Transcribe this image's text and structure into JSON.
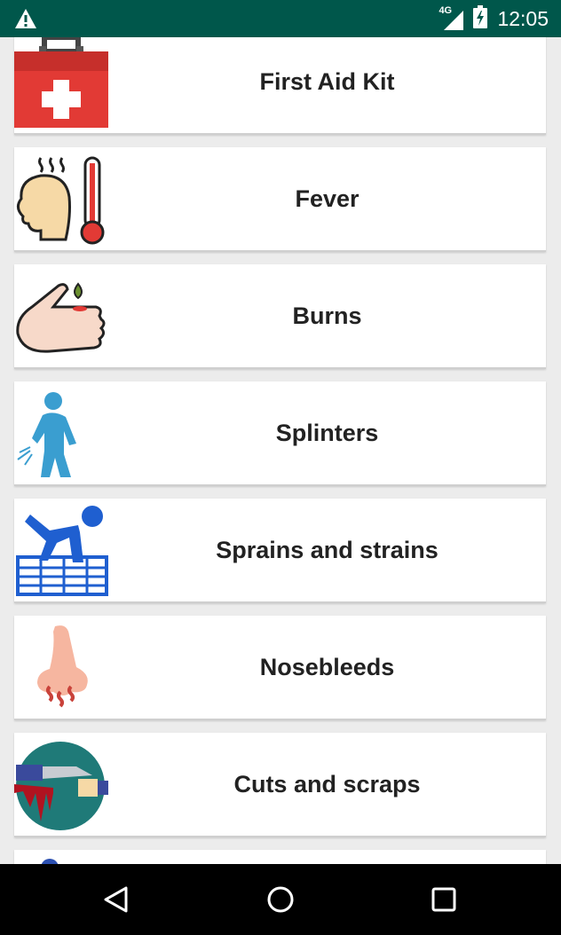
{
  "status_bar": {
    "warning_icon": "warning-triangle-icon",
    "network_label": "4G",
    "time": "12:05"
  },
  "items": [
    {
      "label": "First Aid Kit",
      "icon": "first-aid-kit-icon"
    },
    {
      "label": "Fever",
      "icon": "fever-thermometer-icon"
    },
    {
      "label": "Burns",
      "icon": "burned-hand-icon"
    },
    {
      "label": "Splinters",
      "icon": "person-splinter-icon"
    },
    {
      "label": "Sprains and strains",
      "icon": "slipping-person-icon"
    },
    {
      "label": "Nosebleeds",
      "icon": "nose-icon"
    },
    {
      "label": "Cuts and scraps",
      "icon": "knife-cut-icon"
    },
    {
      "label": "",
      "icon": "person-icon"
    }
  ],
  "nav": {
    "back": "back-icon",
    "home": "home-icon",
    "recents": "recents-icon"
  },
  "colors": {
    "status_bar": "#00574B",
    "card_bg": "#FFFFFF",
    "page_bg": "#ECECEC"
  }
}
